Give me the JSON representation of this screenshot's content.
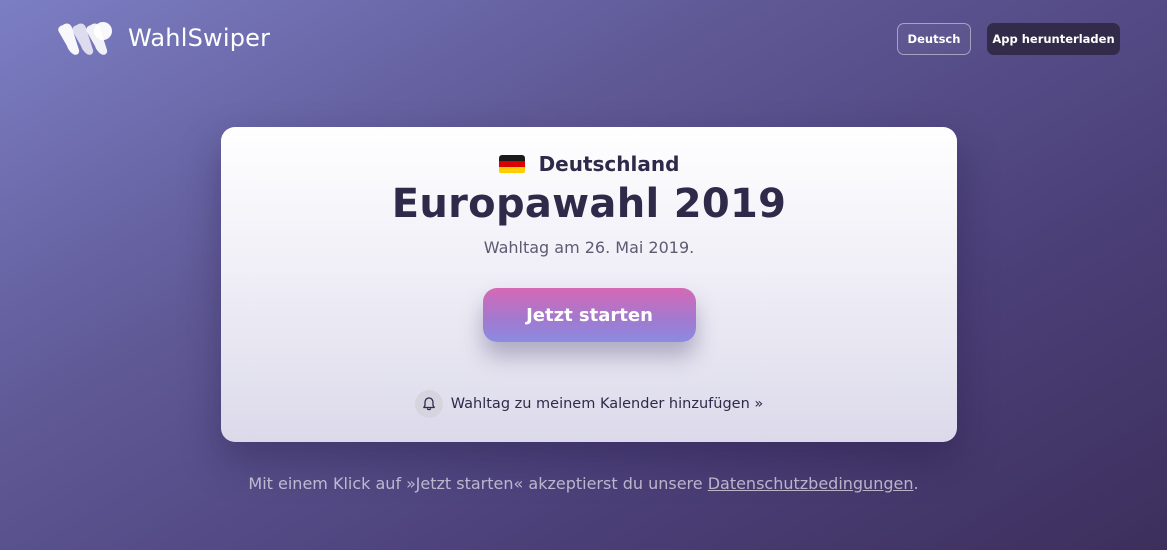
{
  "header": {
    "brand": "WahlSwiper",
    "language_button": "Deutsch",
    "download_button": "App herunterladen"
  },
  "card": {
    "country": "Deutschland",
    "flag_icon": "germany-flag-icon",
    "title": "Europawahl 2019",
    "subtitle": "Wahltag am 26. Mai 2019.",
    "start_button": "Jetzt starten",
    "calendar_icon": "bell-icon",
    "calendar_link": "Wahltag zu meinem Kalender hinzufügen »"
  },
  "footer": {
    "note_prefix": "Mit einem Klick auf »Jetzt starten« akzeptierst du unsere ",
    "privacy_link": "Datenschutzbedingungen",
    "note_suffix": "."
  },
  "colors": {
    "background_start": "#7c7ec4",
    "background_end": "#3d2f5c",
    "text_dark": "#2f2a4a",
    "button_gradient_start": "#d668b6",
    "button_gradient_end": "#8b8be0"
  }
}
